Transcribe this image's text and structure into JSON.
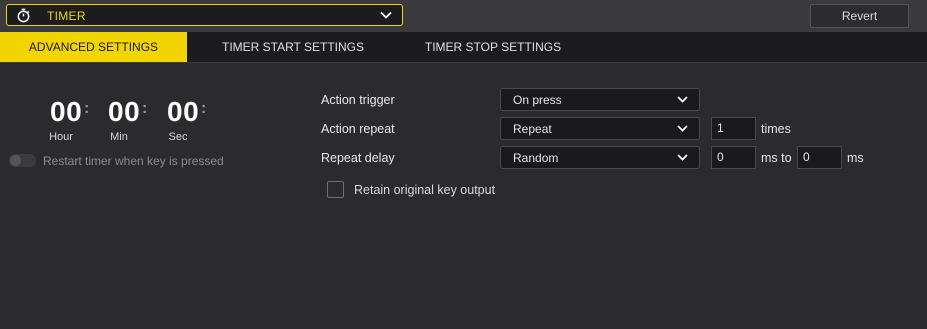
{
  "header": {
    "action_name": "TIMER",
    "action_icon": "stopwatch-icon",
    "revert_label": "Revert",
    "accent_color": "#f2d500"
  },
  "tabs": [
    {
      "label": "ADVANCED SETTINGS",
      "active": true
    },
    {
      "label": "TIMER START SETTINGS",
      "active": false
    },
    {
      "label": "TIMER STOP SETTINGS",
      "active": false
    }
  ],
  "timer": {
    "hour": "00",
    "min": "00",
    "sec": "00",
    "hour_label": "Hour",
    "min_label": "Min",
    "sec_label": "Sec",
    "restart_toggle_label": "Restart timer when key is pressed",
    "restart_toggle_on": false
  },
  "settings": {
    "action_trigger": {
      "label": "Action trigger",
      "value": "On press"
    },
    "action_repeat": {
      "label": "Action repeat",
      "value": "Repeat",
      "count": "1",
      "count_suffix": "times"
    },
    "repeat_delay": {
      "label": "Repeat delay",
      "value": "Random",
      "min": "0",
      "between": "ms to",
      "max": "0",
      "unit": "ms"
    },
    "retain_output": {
      "label": "Retain original key output",
      "checked": false
    }
  }
}
